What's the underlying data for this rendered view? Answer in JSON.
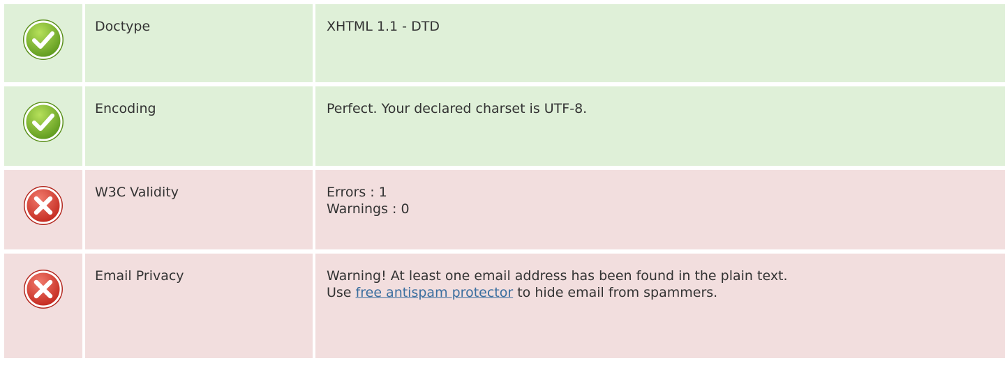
{
  "rows": [
    {
      "status": "pass",
      "icon": "check-circle-icon",
      "name": "Doctype",
      "value_lines": [
        "XHTML 1.1 - DTD"
      ]
    },
    {
      "status": "pass",
      "icon": "check-circle-icon",
      "name": "Encoding",
      "value_lines": [
        "Perfect. Your declared charset is UTF-8."
      ]
    },
    {
      "status": "fail",
      "icon": "error-circle-icon",
      "name": "W3C Validity",
      "value_lines": [
        "Errors : 1",
        "Warnings : 0"
      ]
    },
    {
      "status": "fail",
      "icon": "error-circle-icon",
      "name": "Email Privacy",
      "value_lines": [
        "Warning! At least one email address has been found in the plain text."
      ],
      "line2_prefix": "Use ",
      "line2_link": "free antispam protector",
      "line2_suffix": " to hide email from spammers."
    }
  ],
  "colors": {
    "pass_bg": "#dff0d8",
    "fail_bg": "#f2dede",
    "pass_icon": "#7cb82f",
    "fail_icon": "#d9362b",
    "link": "#3a6e9f"
  }
}
